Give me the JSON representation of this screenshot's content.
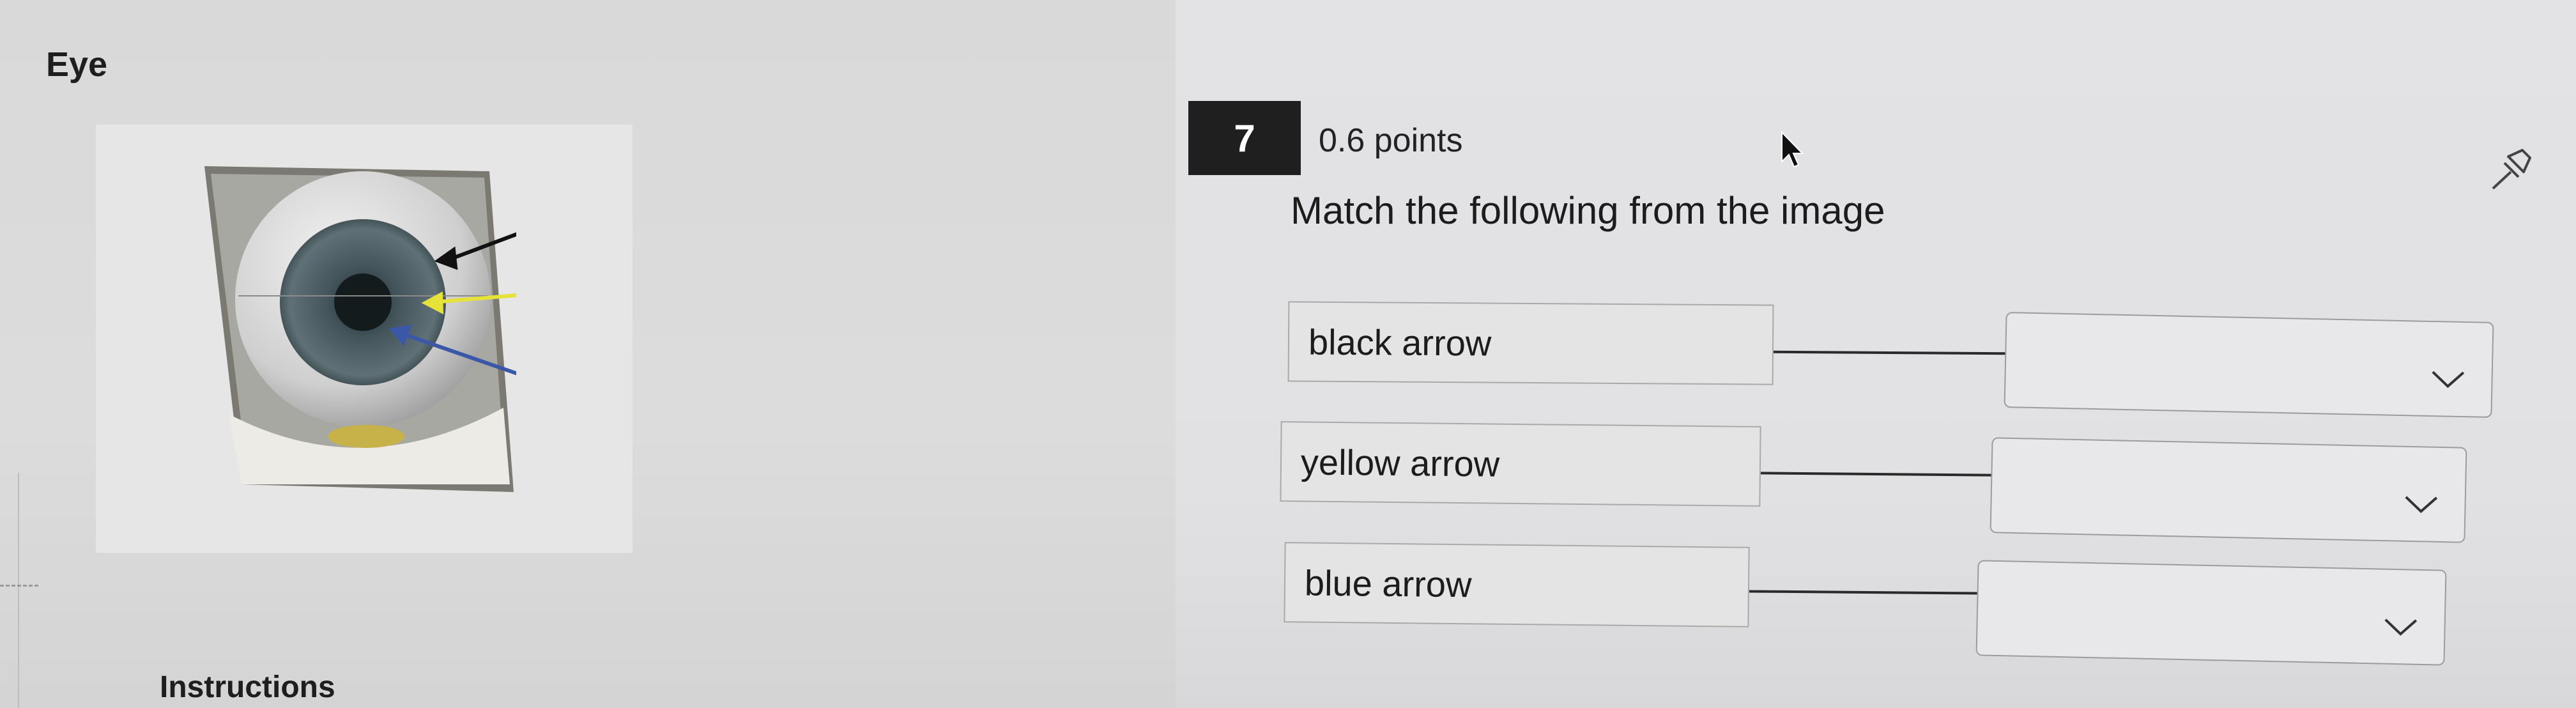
{
  "section": {
    "title": "Eye"
  },
  "image": {
    "alt": "Eye model with arrows",
    "arrows": [
      "black",
      "yellow",
      "blue"
    ]
  },
  "instructions": {
    "label": "Instructions"
  },
  "question": {
    "number": "7",
    "points": "0.6 points",
    "text": "Match the following from the image",
    "items": [
      {
        "prompt": "black arrow",
        "selected": ""
      },
      {
        "prompt": "yellow arrow",
        "selected": ""
      },
      {
        "prompt": "blue arrow",
        "selected": ""
      }
    ]
  },
  "icons": {
    "pin": "pin-icon",
    "chevron": "chevron-down-icon",
    "cursor": "mouse-cursor-icon"
  },
  "colors": {
    "question_number_bg": "#1f1f1f",
    "arrow_black": "#111111",
    "arrow_yellow": "#e5e23a",
    "arrow_blue": "#3b57a8"
  }
}
